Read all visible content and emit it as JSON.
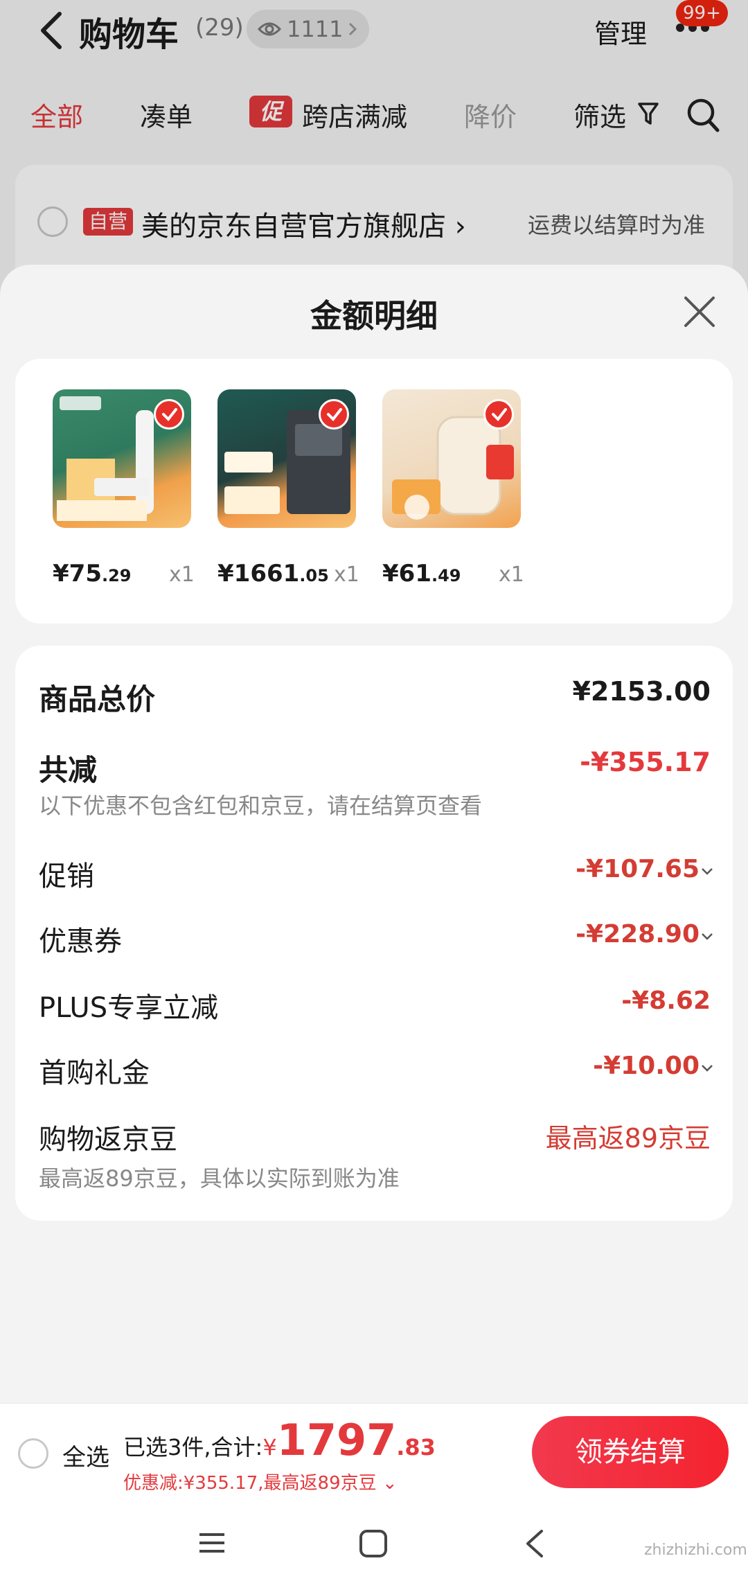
{
  "header": {
    "title": "购物车",
    "count": "(29)",
    "views": "1111",
    "manage": "管理",
    "badge": "99+"
  },
  "filters": {
    "all": "全部",
    "bundle": "凑单",
    "promo_tag": "促",
    "cross_store": "跨店满减",
    "price_drop": "降价",
    "filter": "筛选"
  },
  "store": {
    "self_tag": "自营",
    "name": "美的京东自营官方旗舰店 ›",
    "shipping": "运费以结算时为准"
  },
  "sheet": {
    "title": "金额明细",
    "products": [
      {
        "price_int": "¥75",
        "price_dec": ".29",
        "qty": "x1"
      },
      {
        "price_int": "¥1661",
        "price_dec": ".05",
        "qty": "x1"
      },
      {
        "price_int": "¥61",
        "price_dec": ".49",
        "qty": "x1"
      }
    ],
    "rows": {
      "total_label": "商品总价",
      "total_value": "¥2153.00",
      "reduce_label": "共减",
      "reduce_value": "-¥355.17",
      "reduce_note": "以下优惠不包含红包和京豆，请在结算页查看",
      "promo_label": "促销",
      "promo_value": "-¥107.65",
      "coupon_label": "优惠券",
      "coupon_value": "-¥228.90",
      "plus_label": "PLUS专享立减",
      "plus_value": "-¥8.62",
      "first_label": "首购礼金",
      "first_value": "-¥10.00",
      "beans_label": "购物返京豆",
      "beans_value": "最高返89京豆",
      "beans_note": "最高返89京豆，具体以实际到账为准"
    }
  },
  "bottom": {
    "select_all": "全选",
    "selected": "已选3件,合计:",
    "currency": "¥",
    "total_int": "1797",
    "total_dec": ".83",
    "discount": "优惠减:¥355.17,最高返89京豆 ⌄",
    "checkout": "领券结算"
  },
  "watermark": "zhizhizhi.com",
  "colors": {
    "accent": "#e4393c",
    "checkout": "#f4232e"
  }
}
